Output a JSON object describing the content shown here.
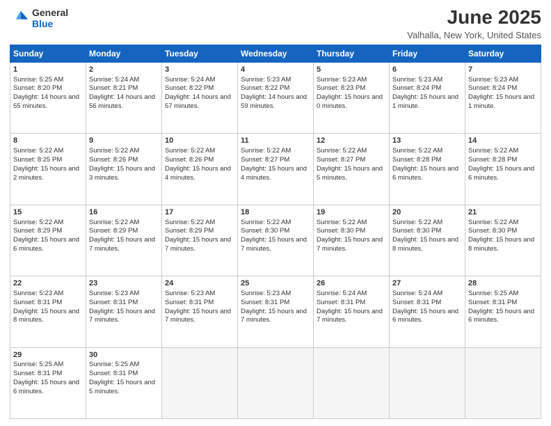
{
  "header": {
    "logo_line1": "General",
    "logo_line2": "Blue",
    "month": "June 2025",
    "location": "Valhalla, New York, United States"
  },
  "days_of_week": [
    "Sunday",
    "Monday",
    "Tuesday",
    "Wednesday",
    "Thursday",
    "Friday",
    "Saturday"
  ],
  "weeks": [
    [
      {
        "day": "1",
        "sunrise": "5:25 AM",
        "sunset": "8:20 PM",
        "daylight": "14 hours and 55 minutes."
      },
      {
        "day": "2",
        "sunrise": "5:24 AM",
        "sunset": "8:21 PM",
        "daylight": "14 hours and 56 minutes."
      },
      {
        "day": "3",
        "sunrise": "5:24 AM",
        "sunset": "8:22 PM",
        "daylight": "14 hours and 57 minutes."
      },
      {
        "day": "4",
        "sunrise": "5:23 AM",
        "sunset": "8:22 PM",
        "daylight": "14 hours and 59 minutes."
      },
      {
        "day": "5",
        "sunrise": "5:23 AM",
        "sunset": "8:23 PM",
        "daylight": "15 hours and 0 minutes."
      },
      {
        "day": "6",
        "sunrise": "5:23 AM",
        "sunset": "8:24 PM",
        "daylight": "15 hours and 1 minute."
      },
      {
        "day": "7",
        "sunrise": "5:23 AM",
        "sunset": "8:24 PM",
        "daylight": "15 hours and 1 minute."
      }
    ],
    [
      {
        "day": "8",
        "sunrise": "5:22 AM",
        "sunset": "8:25 PM",
        "daylight": "15 hours and 2 minutes."
      },
      {
        "day": "9",
        "sunrise": "5:22 AM",
        "sunset": "8:26 PM",
        "daylight": "15 hours and 3 minutes."
      },
      {
        "day": "10",
        "sunrise": "5:22 AM",
        "sunset": "8:26 PM",
        "daylight": "15 hours and 4 minutes."
      },
      {
        "day": "11",
        "sunrise": "5:22 AM",
        "sunset": "8:27 PM",
        "daylight": "15 hours and 4 minutes."
      },
      {
        "day": "12",
        "sunrise": "5:22 AM",
        "sunset": "8:27 PM",
        "daylight": "15 hours and 5 minutes."
      },
      {
        "day": "13",
        "sunrise": "5:22 AM",
        "sunset": "8:28 PM",
        "daylight": "15 hours and 6 minutes."
      },
      {
        "day": "14",
        "sunrise": "5:22 AM",
        "sunset": "8:28 PM",
        "daylight": "15 hours and 6 minutes."
      }
    ],
    [
      {
        "day": "15",
        "sunrise": "5:22 AM",
        "sunset": "8:29 PM",
        "daylight": "15 hours and 6 minutes."
      },
      {
        "day": "16",
        "sunrise": "5:22 AM",
        "sunset": "8:29 PM",
        "daylight": "15 hours and 7 minutes."
      },
      {
        "day": "17",
        "sunrise": "5:22 AM",
        "sunset": "8:29 PM",
        "daylight": "15 hours and 7 minutes."
      },
      {
        "day": "18",
        "sunrise": "5:22 AM",
        "sunset": "8:30 PM",
        "daylight": "15 hours and 7 minutes."
      },
      {
        "day": "19",
        "sunrise": "5:22 AM",
        "sunset": "8:30 PM",
        "daylight": "15 hours and 7 minutes."
      },
      {
        "day": "20",
        "sunrise": "5:22 AM",
        "sunset": "8:30 PM",
        "daylight": "15 hours and 8 minutes."
      },
      {
        "day": "21",
        "sunrise": "5:22 AM",
        "sunset": "8:30 PM",
        "daylight": "15 hours and 8 minutes."
      }
    ],
    [
      {
        "day": "22",
        "sunrise": "5:23 AM",
        "sunset": "8:31 PM",
        "daylight": "15 hours and 8 minutes."
      },
      {
        "day": "23",
        "sunrise": "5:23 AM",
        "sunset": "8:31 PM",
        "daylight": "15 hours and 7 minutes."
      },
      {
        "day": "24",
        "sunrise": "5:23 AM",
        "sunset": "8:31 PM",
        "daylight": "15 hours and 7 minutes."
      },
      {
        "day": "25",
        "sunrise": "5:23 AM",
        "sunset": "8:31 PM",
        "daylight": "15 hours and 7 minutes."
      },
      {
        "day": "26",
        "sunrise": "5:24 AM",
        "sunset": "8:31 PM",
        "daylight": "15 hours and 7 minutes."
      },
      {
        "day": "27",
        "sunrise": "5:24 AM",
        "sunset": "8:31 PM",
        "daylight": "15 hours and 6 minutes."
      },
      {
        "day": "28",
        "sunrise": "5:25 AM",
        "sunset": "8:31 PM",
        "daylight": "15 hours and 6 minutes."
      }
    ],
    [
      {
        "day": "29",
        "sunrise": "5:25 AM",
        "sunset": "8:31 PM",
        "daylight": "15 hours and 6 minutes."
      },
      {
        "day": "30",
        "sunrise": "5:25 AM",
        "sunset": "8:31 PM",
        "daylight": "15 hours and 5 minutes."
      },
      {
        "day": "",
        "sunrise": "",
        "sunset": "",
        "daylight": ""
      },
      {
        "day": "",
        "sunrise": "",
        "sunset": "",
        "daylight": ""
      },
      {
        "day": "",
        "sunrise": "",
        "sunset": "",
        "daylight": ""
      },
      {
        "day": "",
        "sunrise": "",
        "sunset": "",
        "daylight": ""
      },
      {
        "day": "",
        "sunrise": "",
        "sunset": "",
        "daylight": ""
      }
    ]
  ]
}
